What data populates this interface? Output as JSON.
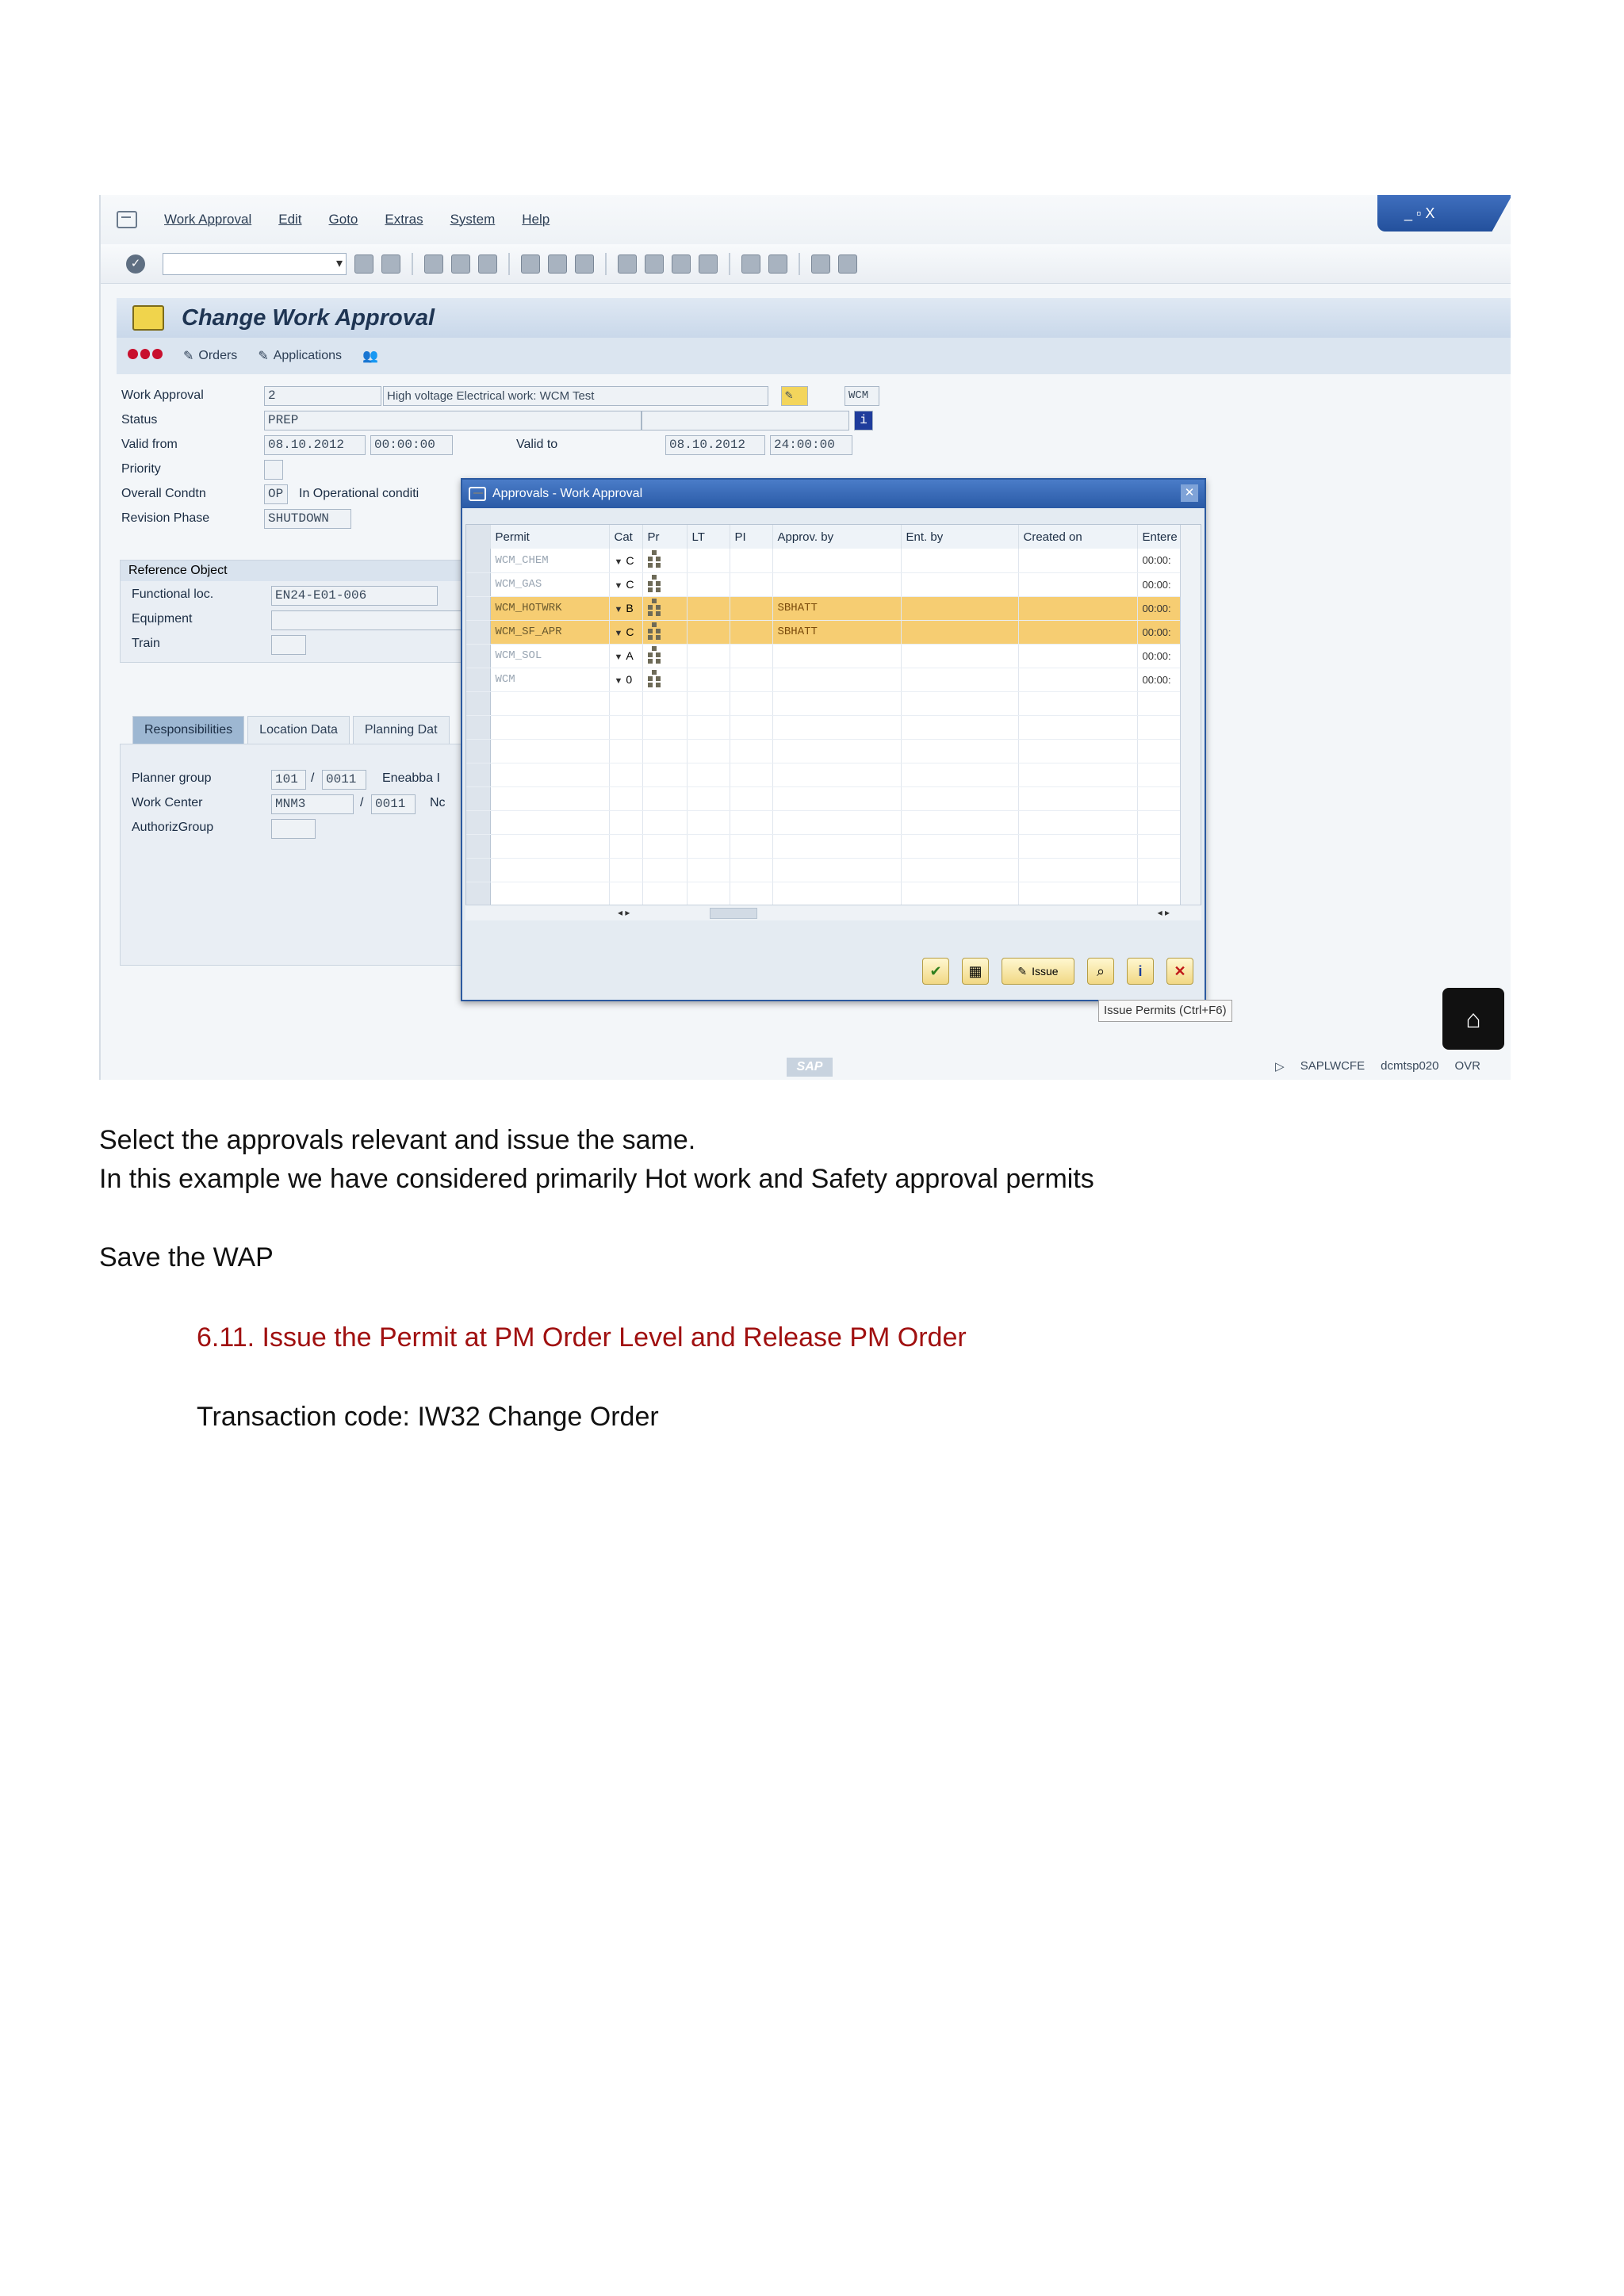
{
  "screenshot": {
    "menu": [
      "Work Approval",
      "Edit",
      "Goto",
      "Extras",
      "System",
      "Help"
    ],
    "window_controls": "_ ▫ X",
    "page_title": "Change Work Approval",
    "appbar": {
      "orders": "Orders",
      "applications": "Applications"
    },
    "form": {
      "work_approval_label": "Work Approval",
      "work_approval_value": "2",
      "work_approval_desc": "High voltage Electrical work: WCM Test",
      "wcm_tag": "WCM",
      "status_label": "Status",
      "status_value": "PREP",
      "valid_from_label": "Valid from",
      "valid_from_date": "08.10.2012",
      "valid_from_time": "00:00:00",
      "valid_to_label": "Valid to",
      "valid_to_date": "08.10.2012",
      "valid_to_time": "24:00:00",
      "priority_label": "Priority",
      "overall_cond_label": "Overall Condtn",
      "overall_cond_value": "OP",
      "overall_cond_desc": "In Operational conditi",
      "revision_label": "Revision Phase",
      "revision_value": "SHUTDOWN"
    },
    "reference": {
      "heading": "Reference Object",
      "functional_loc_label": "Functional loc.",
      "functional_loc_value": "EN24-E01-006",
      "equipment_label": "Equipment",
      "train_label": "Train"
    },
    "tabs": [
      "Responsibilities",
      "Location Data",
      "Planning Dat"
    ],
    "responsibilities": {
      "planner_group_label": "Planner group",
      "planner_group_value": "101",
      "planner_group_plant": "0011",
      "planner_group_desc": "Eneabba I",
      "work_center_label": "Work Center",
      "work_center_value": "MNM3",
      "work_center_plant": "0011",
      "work_center_desc": "Nc",
      "authoriz_label": "AuthorizGroup"
    },
    "popup": {
      "title": "Approvals - Work Approval",
      "columns": [
        "Permit",
        "Cat",
        "Pr",
        "LT",
        "PI",
        "Approv. by",
        "Ent. by",
        "Created on",
        "Entere"
      ],
      "rows": [
        {
          "permit": "WCM_CHEM",
          "cat": "C",
          "approv_by": "",
          "time": "00:00:",
          "highlight": false
        },
        {
          "permit": "WCM_GAS",
          "cat": "C",
          "approv_by": "",
          "time": "00:00:",
          "highlight": false
        },
        {
          "permit": "WCM_HOTWRK",
          "cat": "B",
          "approv_by": "SBHATT",
          "time": "00:00:",
          "highlight": true
        },
        {
          "permit": "WCM_SF_APR",
          "cat": "C",
          "approv_by": "SBHATT",
          "time": "00:00:",
          "highlight": true
        },
        {
          "permit": "WCM_SOL",
          "cat": "A",
          "approv_by": "",
          "time": "00:00:",
          "highlight": false
        },
        {
          "permit": "WCM",
          "cat": "0",
          "approv_by": "",
          "time": "00:00:",
          "highlight": false
        }
      ],
      "issue_button": "Issue",
      "tooltip": "Issue Permits (Ctrl+F6)"
    },
    "statusbar": {
      "logo": "SAP",
      "program": "SAPLWCFE",
      "server": "dcmtsp020",
      "mode": "OVR"
    }
  },
  "document": {
    "line1": "Select the approvals relevant and issue the same.",
    "line2": "In this example we have considered primarily Hot work and Safety approval permits",
    "line3": "Save the WAP",
    "section_heading": "6.11. Issue the Permit at PM Order Level and Release PM Order",
    "transaction": "Transaction code: IW32 Change Order"
  }
}
